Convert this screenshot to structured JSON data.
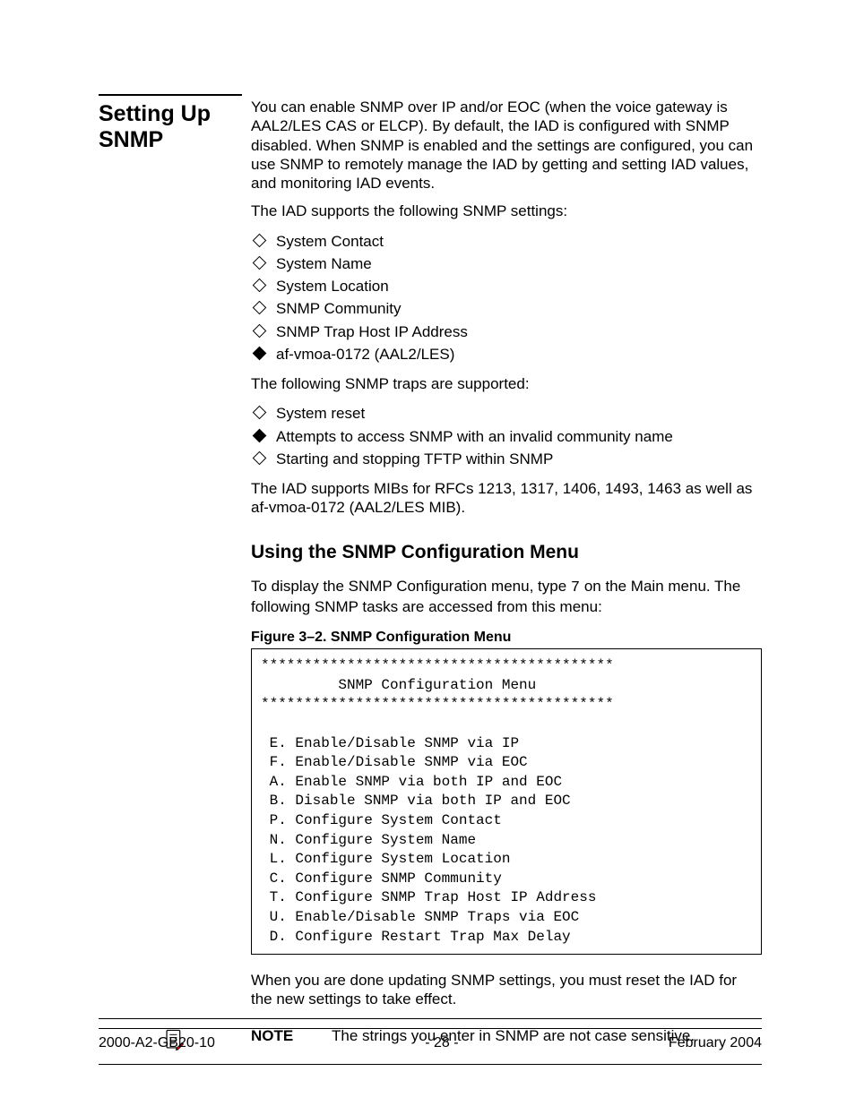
{
  "sidebar": {
    "heading_line1": "Setting Up",
    "heading_line2": "SNMP"
  },
  "intro": {
    "p1": "You can enable SNMP over IP and/or EOC (when the voice gateway is AAL2/LES CAS or ELCP). By default, the IAD is configured with SNMP disabled. When SNMP is enabled and the settings are configured, you can use SNMP to remotely manage the IAD by getting and setting IAD values, and monitoring IAD events.",
    "p2": "The IAD supports the following SNMP settings:"
  },
  "settings_list": [
    "System Contact",
    "System Name",
    "System Location",
    "SNMP Community",
    "SNMP Trap Host IP Address",
    "af-vmoa-0172 (AAL2/LES)"
  ],
  "traps_intro": "The following SNMP traps are supported:",
  "traps_list": [
    "System reset",
    "Attempts to access SNMP with an invalid community name",
    "Starting and stopping TFTP within SNMP"
  ],
  "mibs": "The IAD supports MIBs for RFCs 1213, 1317, 1406, 1493, 1463 as well as af-vmoa-0172 (AAL2/LES MIB).",
  "subhead": "Using the SNMP Configuration Menu",
  "display_intro_pre": "To display the SNMP Configuration menu, type ",
  "display_intro_key": "7",
  "display_intro_post": " on the Main menu. The following SNMP tasks are accessed from this menu:",
  "figure": {
    "caption": "Figure 3–2.  SNMP Configuration Menu",
    "body": "*****************************************\n         SNMP Configuration Menu\n*****************************************\n\n E. Enable/Disable SNMP via IP\n F. Enable/Disable SNMP via EOC\n A. Enable SNMP via both IP and EOC\n B. Disable SNMP via both IP and EOC\n P. Configure System Contact\n N. Configure System Name\n L. Configure System Location\n C. Configure SNMP Community\n T. Configure SNMP Trap Host IP Address\n U. Enable/Disable SNMP Traps via EOC\n D. Configure Restart Trap Max Delay"
  },
  "after_fig": "When you are done updating SNMP settings, you must reset the IAD for the new settings to take effect.",
  "note": {
    "label": "NOTE",
    "text": "The strings you enter in SNMP are not case sensitive."
  },
  "footer": {
    "left": "2000-A2-GB20-10",
    "center": "- 28 -",
    "right": "February 2004"
  },
  "icons": {
    "note": "note-icon"
  }
}
